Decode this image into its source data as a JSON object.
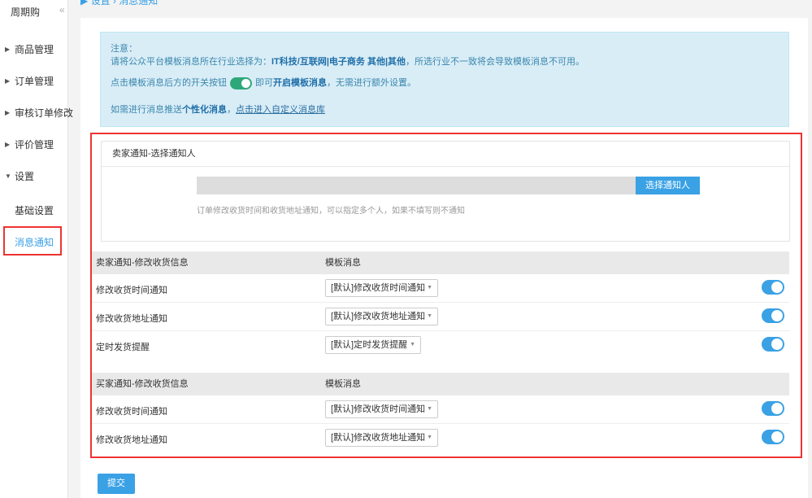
{
  "sidebar": {
    "brand": "周期购",
    "collapse": "«",
    "items": [
      {
        "label": "商品管理",
        "arrow": "▶"
      },
      {
        "label": "订单管理",
        "arrow": "▶"
      },
      {
        "label": "审核订单修改",
        "arrow": "▶"
      },
      {
        "label": "评价管理",
        "arrow": "▶"
      },
      {
        "label": "设置",
        "arrow": "▼"
      }
    ],
    "sub": [
      {
        "label": "基础设置"
      },
      {
        "label": "消息通知"
      }
    ]
  },
  "breadcrumb_cut": "▶ 设置 › 消息通知",
  "notice": {
    "title": "注意：",
    "line1_pre": "请将公众平台模板消息所在行业选择为：",
    "line1_bold": "IT科技/互联网|电子商务 其他|其他",
    "line1_post": "，所选行业不一致将会导致模板消息不可用。",
    "line2_pre": "点击模板消息后方的开关按钮",
    "line2_mid": "即可",
    "line2_bold": "开启模板消息",
    "line2_post": "，无需进行额外设置。",
    "line3_pre": "如需进行消息推送",
    "line3_bold": "个性化消息",
    "line3_mid": "，",
    "line3_link": "点击进入自定义消息库"
  },
  "seller_panel": {
    "title": "卖家通知-选择通知人",
    "input_value": "",
    "button": "选择通知人",
    "help": "订单修改收货时间和收货地址通知，可以指定多个人，如果不填写则不通知"
  },
  "seller_table": {
    "col1": "卖家通知-修改收货信息",
    "col2": "模板消息",
    "rows": [
      {
        "name": "修改收货时间通知",
        "template": "[默认]修改收货时间通知",
        "enabled": true
      },
      {
        "name": "修改收货地址通知",
        "template": "[默认]修改收货地址通知",
        "enabled": true
      },
      {
        "name": "定时发货提醒",
        "template": "[默认]定时发货提醒",
        "enabled": true
      }
    ]
  },
  "buyer_table": {
    "col1": "买家通知-修改收货信息",
    "col2": "模板消息",
    "rows": [
      {
        "name": "修改收货时间通知",
        "template": "[默认]修改收货时间通知",
        "enabled": true
      },
      {
        "name": "修改收货地址通知",
        "template": "[默认]修改收货地址通知",
        "enabled": true
      }
    ]
  },
  "submit": "提交",
  "caret": "▼",
  "colors": {
    "accent": "#3aa1e5",
    "highlight": "#ee3333",
    "notice_bg": "#d9edf7"
  }
}
